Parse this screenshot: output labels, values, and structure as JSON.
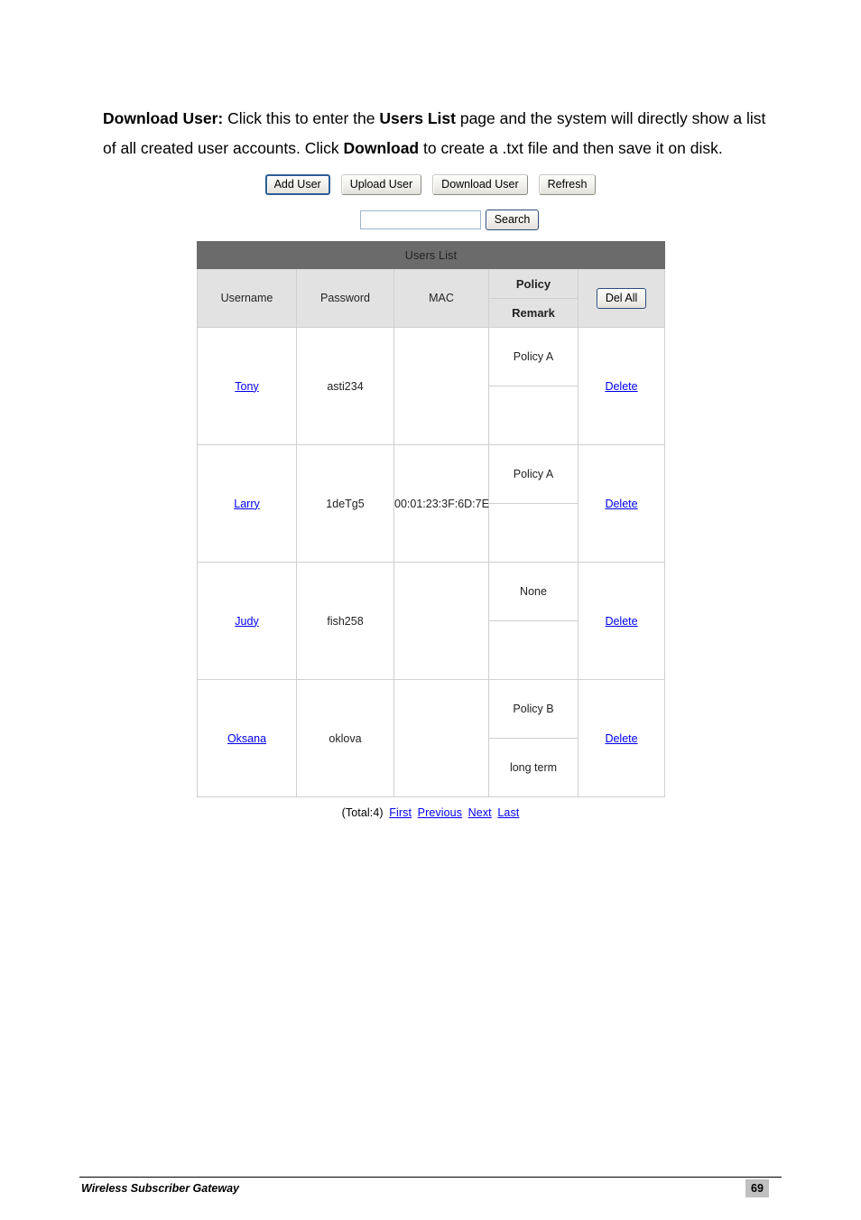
{
  "document": {
    "paragraph": {
      "lead_label": "Download User:",
      "part1": " Click this to enter the ",
      "emph1": "Users List",
      "part2": " page and the system will directly show a list of all created user accounts. Click ",
      "emph2": "Download",
      "part3": " to create a .txt file and then save it on disk."
    },
    "footer": {
      "title": "Wireless Subscriber Gateway",
      "page_number": "69"
    }
  },
  "screenshot": {
    "toolbar": {
      "add_user": "Add User",
      "upload_user": "Upload User",
      "download_user": "Download User",
      "refresh": "Refresh",
      "focused_button": "Add User"
    },
    "search": {
      "value": "",
      "placeholder": "",
      "button_label": "Search"
    },
    "table": {
      "title": "Users List",
      "columns": {
        "username": "Username",
        "password": "Password",
        "mac": "MAC",
        "policy": "Policy",
        "remark": "Remark",
        "del_all": "Del All"
      },
      "rows": [
        {
          "username": "Tony",
          "password": "asti234",
          "mac": "",
          "policy": "Policy A",
          "remark": "",
          "action": "Delete"
        },
        {
          "username": "Larry",
          "password": "1deTg5",
          "mac": "00:01:23:3F:6D:7E",
          "policy": "Policy A",
          "remark": "",
          "action": "Delete"
        },
        {
          "username": "Judy",
          "password": "fish258",
          "mac": "",
          "policy": "None",
          "remark": "",
          "action": "Delete"
        },
        {
          "username": "Oksana",
          "password": "oklova",
          "mac": "",
          "policy": "Policy B",
          "remark": "long term",
          "action": "Delete"
        }
      ]
    },
    "pagination": {
      "total": "(Total:4)",
      "first": "First",
      "previous": "Previous",
      "next": "Next",
      "last": "Last"
    }
  },
  "colors": {
    "title_bar": "#6b6b6b",
    "header_cell": "#e2e2e2",
    "link": "#0000ee",
    "focus_border": "#2c5d96",
    "page_badge": "#c0c0c0"
  }
}
